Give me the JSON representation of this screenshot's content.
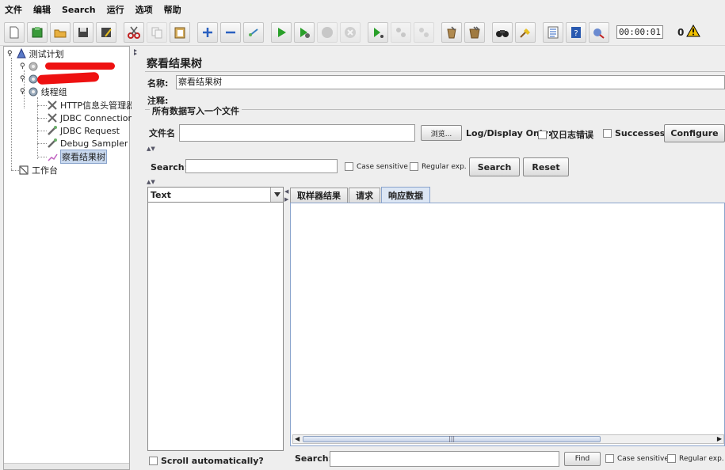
{
  "menu": [
    "文件",
    "编辑",
    "Search",
    "运行",
    "选项",
    "帮助"
  ],
  "toolbar": {
    "icons": [
      "new-icon",
      "template-icon",
      "open-icon",
      "save-icon",
      "save-as-icon",
      "cut-icon",
      "copy-icon",
      "paste-icon",
      "expand-icon",
      "collapse-icon",
      "toggle-icon",
      "start-icon",
      "start-no-pause-icon",
      "stop-icon",
      "shutdown-icon",
      "remote-start-icon",
      "remote-stop-icon",
      "remote-shutdown-icon",
      "clear-icon",
      "clear-all-icon",
      "search-icon",
      "reset-search-icon",
      "function-helper-icon",
      "help-icon",
      "log-viewer-icon"
    ],
    "timer": "00:00:01",
    "warning_count": "0"
  },
  "tree": {
    "root": "测试计划",
    "thread_group": "线程组",
    "children": [
      "HTTP信息头管理器",
      "JDBC Connection",
      "JDBC Request",
      "Debug Sampler",
      "察看结果树"
    ],
    "workbench": "工作台"
  },
  "panel": {
    "title": "察看结果树",
    "name_label": "名称:",
    "name_value": "察看结果树",
    "comment_label": "注释:",
    "group_title": "所有数据写入一个文件",
    "filename_label": "文件名",
    "browse_label": "浏览...",
    "log_display_label": "Log/Display Only:",
    "errors_only_label": "仅日志错误",
    "successes_label": "Successes",
    "configure_label": "Configure"
  },
  "search": {
    "label": "Search:",
    "case_label": "Case sensitive",
    "regex_label": "Regular exp.",
    "search_button": "Search",
    "reset_button": "Reset"
  },
  "results": {
    "renderer": "Text",
    "scroll_auto_label": "Scroll automatically?",
    "tabs": [
      "取样器结果",
      "请求",
      "响应数据"
    ],
    "active_tab": 2,
    "bottom_search_label": "Search:",
    "find_label": "Find",
    "bottom_case_label": "Case sensitive",
    "bottom_regex_label": "Regular exp."
  }
}
